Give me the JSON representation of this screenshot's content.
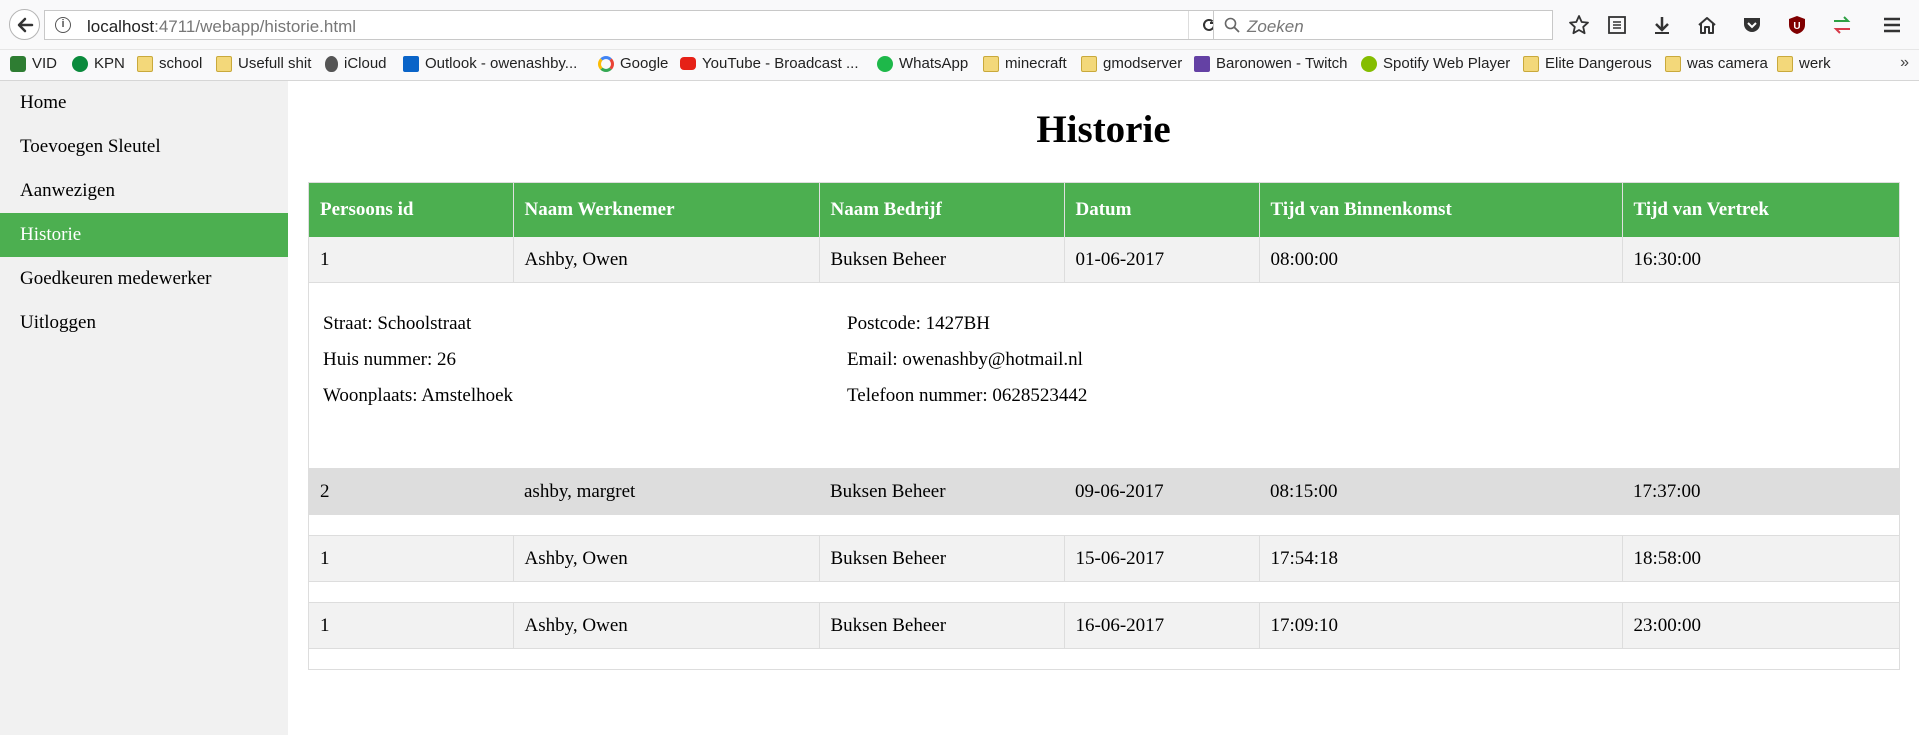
{
  "browser": {
    "url_host": "localhost",
    "url_path": ":4711/webapp/historie.html",
    "search_placeholder": "Zoeken"
  },
  "bookmarks": [
    {
      "label": "VID",
      "icon": "vid-icon"
    },
    {
      "label": "KPN",
      "icon": "kpn-icon"
    },
    {
      "label": "school",
      "icon": "folder-icon"
    },
    {
      "label": "Usefull shit",
      "icon": "folder-icon"
    },
    {
      "label": "iCloud",
      "icon": "apple-icon"
    },
    {
      "label": "Outlook - owenashby...",
      "icon": "outlook-icon"
    },
    {
      "label": "Google",
      "icon": "google-icon"
    },
    {
      "label": "YouTube - Broadcast ...",
      "icon": "youtube-icon"
    },
    {
      "label": "WhatsApp",
      "icon": "whatsapp-icon"
    },
    {
      "label": "minecraft",
      "icon": "folder-icon"
    },
    {
      "label": "gmodserver",
      "icon": "folder-icon"
    },
    {
      "label": "Baronowen - Twitch",
      "icon": "twitch-icon"
    },
    {
      "label": "Spotify Web Player",
      "icon": "spotify-icon"
    },
    {
      "label": "Elite Dangerous",
      "icon": "folder-icon"
    },
    {
      "label": "was camera",
      "icon": "folder-icon"
    },
    {
      "label": "werk",
      "icon": "folder-icon"
    }
  ],
  "sidebar": {
    "items": [
      {
        "label": "Home",
        "active": false
      },
      {
        "label": "Toevoegen Sleutel",
        "active": false
      },
      {
        "label": "Aanwezigen",
        "active": false
      },
      {
        "label": "Historie",
        "active": true
      },
      {
        "label": "Goedkeuren medewerker",
        "active": false
      },
      {
        "label": "Uitloggen",
        "active": false
      }
    ]
  },
  "page": {
    "title": "Historie"
  },
  "table": {
    "headers": [
      "Persoons id",
      "Naam Werknemer",
      "Naam Bedrijf",
      "Datum",
      "Tijd van Binnenkomst",
      "Tijd van Vertrek"
    ],
    "rows": [
      [
        "1",
        "Ashby, Owen",
        "Buksen Beheer",
        "01-06-2017",
        "08:00:00",
        "16:30:00"
      ],
      [
        "2",
        "ashby, margret",
        "Buksen Beheer",
        "09-06-2017",
        "08:15:00",
        "17:37:00"
      ],
      [
        "1",
        "Ashby, Owen",
        "Buksen Beheer",
        "15-06-2017",
        "17:54:18",
        "18:58:00"
      ],
      [
        "1",
        "Ashby, Owen",
        "Buksen Beheer",
        "16-06-2017",
        "17:09:10",
        "23:00:00"
      ]
    ],
    "detail": {
      "straat": "Straat: Schoolstraat",
      "huisnummer": "Huis nummer: 26",
      "woonplaats": "Woonplaats: Amstelhoek",
      "postcode": "Postcode: 1427BH",
      "email": "Email: owenashby@hotmail.nl",
      "telefoon": "Telefoon nummer: 0628523442"
    }
  },
  "colors": {
    "accent": "#4caf50",
    "sidebar_bg": "#f1f1f1",
    "row_bg": "#f2f2f2",
    "row_highlight": "#dddddd"
  }
}
